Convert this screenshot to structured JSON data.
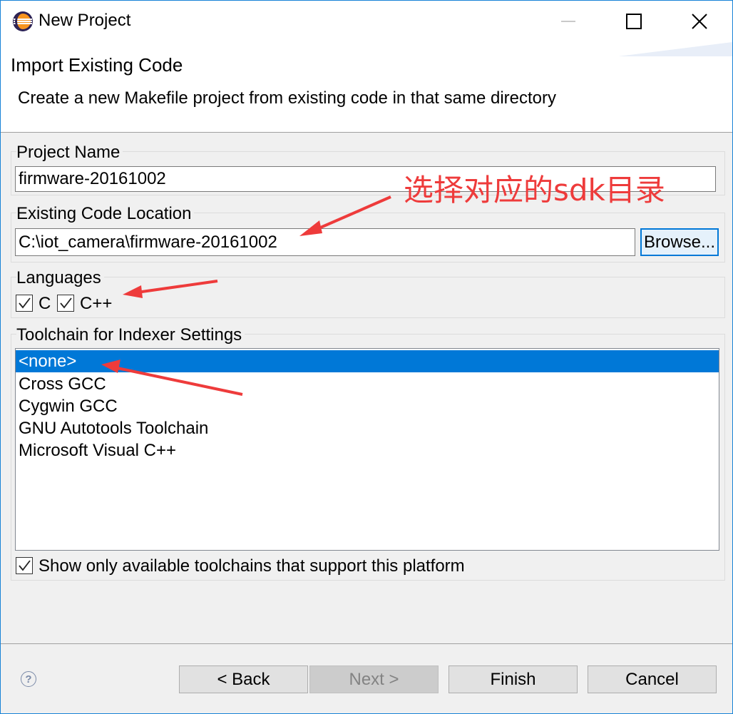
{
  "window": {
    "title": "New Project",
    "icons": {
      "app": "eclipse-icon",
      "minimize": "minimize-icon",
      "maximize": "maximize-icon",
      "close": "close-icon"
    }
  },
  "header": {
    "title": "Import Existing Code",
    "description": "Create a new Makefile project from existing code in that same directory"
  },
  "project_name": {
    "label": "Project Name",
    "value": "firmware-20161002"
  },
  "code_location": {
    "label": "Existing Code Location",
    "value": "C:\\iot_camera\\firmware-20161002",
    "browse_label": "Browse..."
  },
  "languages": {
    "label": "Languages",
    "options": [
      {
        "label": "C",
        "checked": true
      },
      {
        "label": "C++",
        "checked": true
      }
    ]
  },
  "toolchain": {
    "label": "Toolchain for Indexer Settings",
    "items": [
      "<none>",
      "Cross GCC",
      "Cygwin GCC",
      "GNU Autotools Toolchain",
      "Microsoft Visual C++"
    ],
    "selected_index": 0,
    "show_only_label": "Show only available toolchains that support this platform",
    "show_only_checked": true
  },
  "buttons": {
    "back": "< Back",
    "next": "Next >",
    "finish": "Finish",
    "cancel": "Cancel"
  },
  "help_icon": "help-icon",
  "annotation": {
    "text": "选择对应的sdk目录",
    "color": "#ee3b3b"
  },
  "colors": {
    "accent": "#0078d7",
    "window_border": "#1883d7"
  }
}
